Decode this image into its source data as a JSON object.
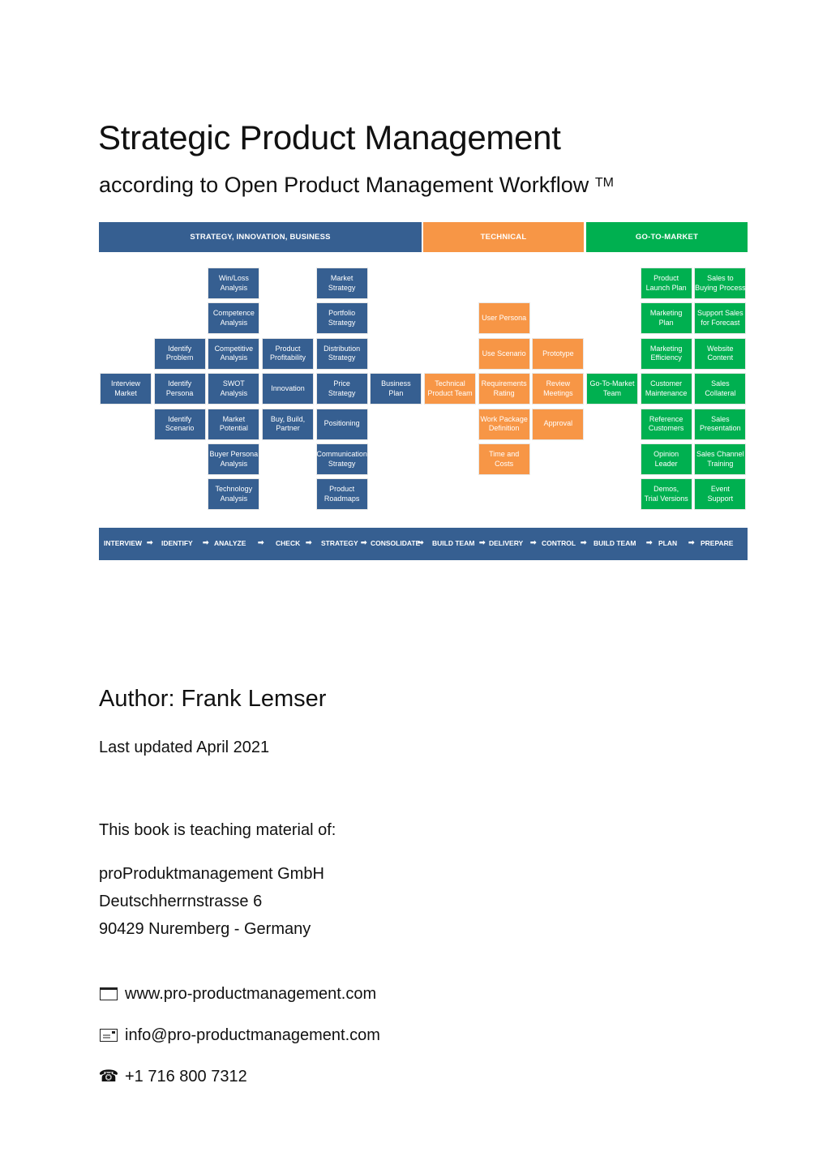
{
  "title": "Strategic Product Management",
  "subtitle": "according to Open Product Management Workflow",
  "subtitle_mark": "TM",
  "colors": {
    "strategy": "#365f91",
    "technical": "#f79646",
    "gtm": "#00b050"
  },
  "diagram": {
    "headers": [
      {
        "label": "STRATEGY, INNOVATION, BUSINESS",
        "group": "strategy"
      },
      {
        "label": "TECHNICAL",
        "group": "technical"
      },
      {
        "label": "GO-TO-MARKET",
        "group": "gtm"
      }
    ],
    "boxes": [
      {
        "label": "Interview\nMarket",
        "col": 0,
        "row": 3,
        "group": "strategy"
      },
      {
        "label": "Identify\nProblem",
        "col": 1,
        "row": 2,
        "group": "strategy"
      },
      {
        "label": "Identify\nPersona",
        "col": 1,
        "row": 3,
        "group": "strategy"
      },
      {
        "label": "Identify\nScenario",
        "col": 1,
        "row": 4,
        "group": "strategy"
      },
      {
        "label": "Win/Loss\nAnalysis",
        "col": 2,
        "row": 0,
        "group": "strategy"
      },
      {
        "label": "Competence\nAnalysis",
        "col": 2,
        "row": 1,
        "group": "strategy"
      },
      {
        "label": "Competitive\nAnalysis",
        "col": 2,
        "row": 2,
        "group": "strategy"
      },
      {
        "label": "SWOT\nAnalysis",
        "col": 2,
        "row": 3,
        "group": "strategy"
      },
      {
        "label": "Market\nPotential",
        "col": 2,
        "row": 4,
        "group": "strategy"
      },
      {
        "label": "Buyer Persona\nAnalysis",
        "col": 2,
        "row": 5,
        "group": "strategy"
      },
      {
        "label": "Technology\nAnalysis",
        "col": 2,
        "row": 6,
        "group": "strategy"
      },
      {
        "label": "Product\nProfitability",
        "col": 3,
        "row": 2,
        "group": "strategy"
      },
      {
        "label": "Innovation",
        "col": 3,
        "row": 3,
        "group": "strategy"
      },
      {
        "label": "Buy, Build,\nPartner",
        "col": 3,
        "row": 4,
        "group": "strategy"
      },
      {
        "label": "Market\nStrategy",
        "col": 4,
        "row": 0,
        "group": "strategy"
      },
      {
        "label": "Portfolio\nStrategy",
        "col": 4,
        "row": 1,
        "group": "strategy"
      },
      {
        "label": "Distribution\nStrategy",
        "col": 4,
        "row": 2,
        "group": "strategy"
      },
      {
        "label": "Price\nStrategy",
        "col": 4,
        "row": 3,
        "group": "strategy"
      },
      {
        "label": "Positioning",
        "col": 4,
        "row": 4,
        "group": "strategy"
      },
      {
        "label": "Communication\nStrategy",
        "col": 4,
        "row": 5,
        "group": "strategy"
      },
      {
        "label": "Product\nRoadmaps",
        "col": 4,
        "row": 6,
        "group": "strategy"
      },
      {
        "label": "Business\nPlan",
        "col": 5,
        "row": 3,
        "group": "strategy"
      },
      {
        "label": "Technical\nProduct Team",
        "col": 6,
        "row": 3,
        "group": "technical"
      },
      {
        "label": "User Persona",
        "col": 7,
        "row": 1,
        "group": "technical"
      },
      {
        "label": "Use Scenario",
        "col": 7,
        "row": 2,
        "group": "technical"
      },
      {
        "label": "Requirements\nRating",
        "col": 7,
        "row": 3,
        "group": "technical"
      },
      {
        "label": "Work Package\nDefinition",
        "col": 7,
        "row": 4,
        "group": "technical"
      },
      {
        "label": "Time and\nCosts",
        "col": 7,
        "row": 5,
        "group": "technical"
      },
      {
        "label": "Prototype",
        "col": 8,
        "row": 2,
        "group": "technical"
      },
      {
        "label": "Review\nMeetings",
        "col": 8,
        "row": 3,
        "group": "technical"
      },
      {
        "label": "Approval",
        "col": 8,
        "row": 4,
        "group": "technical"
      },
      {
        "label": "Go-To-Market\nTeam",
        "col": 9,
        "row": 3,
        "group": "gtm"
      },
      {
        "label": "Product\nLaunch Plan",
        "col": 10,
        "row": 0,
        "group": "gtm"
      },
      {
        "label": "Marketing\nPlan",
        "col": 10,
        "row": 1,
        "group": "gtm"
      },
      {
        "label": "Marketing\nEfficiency",
        "col": 10,
        "row": 2,
        "group": "gtm"
      },
      {
        "label": "Customer\nMaintenance",
        "col": 10,
        "row": 3,
        "group": "gtm"
      },
      {
        "label": "Reference\nCustomers",
        "col": 10,
        "row": 4,
        "group": "gtm"
      },
      {
        "label": "Opinion\nLeader",
        "col": 10,
        "row": 5,
        "group": "gtm"
      },
      {
        "label": "Demos,\nTrial Versions",
        "col": 10,
        "row": 6,
        "group": "gtm"
      },
      {
        "label": "Sales to\nBuying Process",
        "col": 11,
        "row": 0,
        "group": "gtm"
      },
      {
        "label": "Support Sales\nfor Forecast",
        "col": 11,
        "row": 1,
        "group": "gtm"
      },
      {
        "label": "Website\nContent",
        "col": 11,
        "row": 2,
        "group": "gtm"
      },
      {
        "label": "Sales\nCollateral",
        "col": 11,
        "row": 3,
        "group": "gtm"
      },
      {
        "label": "Sales\nPresentation",
        "col": 11,
        "row": 4,
        "group": "gtm"
      },
      {
        "label": "Sales Channel\nTraining",
        "col": 11,
        "row": 5,
        "group": "gtm"
      },
      {
        "label": "Event\nSupport",
        "col": 11,
        "row": 6,
        "group": "gtm"
      }
    ],
    "flow_steps": [
      "INTERVIEW",
      "IDENTIFY",
      "ANALYZE",
      "CHECK",
      "STRATEGY",
      "CONSOLIDATE",
      "BUILD TEAM",
      "DELIVERY",
      "CONTROL",
      "BUILD TEAM",
      "PLAN",
      "PREPARE"
    ],
    "flow_arrow": "➡"
  },
  "author": "Author: Frank Lemser",
  "updated": "Last updated April 2021",
  "teaching": "This book is teaching material of:",
  "company": [
    "proProduktmanagement GmbH",
    "Deutschherrnstrasse 6",
    "90429 Nuremberg - Germany"
  ],
  "contacts": [
    {
      "icon": "web-window-icon",
      "text": "www.pro-productmanagement.com"
    },
    {
      "icon": "email-icon",
      "text": "info@pro-productmanagement.com"
    },
    {
      "icon": "phone-icon",
      "text": "+1 716 800 7312"
    }
  ]
}
